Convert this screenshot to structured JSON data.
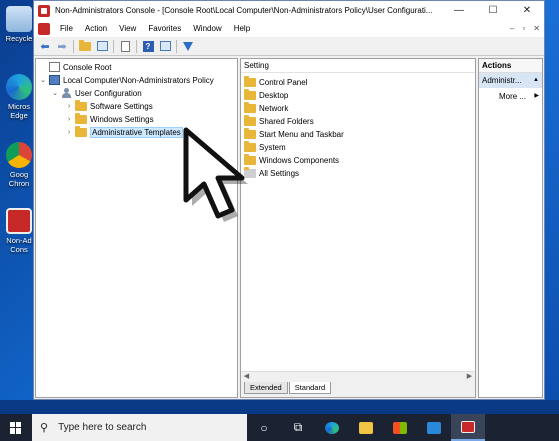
{
  "desktop": {
    "icons": [
      {
        "label": "Recycle",
        "icon": "recycle-bin-icon"
      },
      {
        "label": "Micros Edge",
        "icon": "edge-icon"
      },
      {
        "label": "Goog Chron",
        "icon": "chrome-icon"
      },
      {
        "label": "Non-Ad Cons",
        "icon": "mmc-shortcut-icon"
      }
    ]
  },
  "window": {
    "title": "Non-Administrators Console - [Console Root\\Local Computer\\Non-Administrators Policy\\User Configurati...",
    "controls": {
      "minimize": "—",
      "maximize": "☐",
      "close": "✕"
    },
    "menu": [
      "File",
      "Action",
      "View",
      "Favorites",
      "Window",
      "Help"
    ],
    "mdi_controls": {
      "minimize": "–",
      "restore": "▫",
      "close": "✕"
    }
  },
  "tree": {
    "nodes": [
      {
        "label": "Console Root",
        "level": 0,
        "icon": "console-root-icon",
        "expander": ""
      },
      {
        "label": "Local Computer\\Non-Administrators Policy",
        "level": 1,
        "icon": "computer-policy-icon",
        "expander": "⌄"
      },
      {
        "label": "User Configuration",
        "level": 2,
        "icon": "user-config-icon",
        "expander": "⌄"
      },
      {
        "label": "Software Settings",
        "level": 3,
        "icon": "folder-icon",
        "expander": "›"
      },
      {
        "label": "Windows Settings",
        "level": 3,
        "icon": "folder-icon",
        "expander": "›"
      },
      {
        "label": "Administrative Templates",
        "level": 3,
        "icon": "folder-icon",
        "expander": "›",
        "selected": true
      }
    ]
  },
  "list": {
    "column_header": "Setting",
    "items": [
      "Control Panel",
      "Desktop",
      "Network",
      "Shared Folders",
      "Start Menu and Taskbar",
      "System",
      "Windows Components",
      "All Settings"
    ],
    "tabs": [
      "Extended",
      "Standard"
    ],
    "active_tab": "Standard"
  },
  "actions": {
    "header": "Actions",
    "section": "Administr...",
    "more": "More ...",
    "section_arrow": "▲",
    "more_arrow": "▶"
  },
  "taskbar": {
    "search_placeholder": "Type here to search",
    "apps": [
      "task-view-icon",
      "edge-icon",
      "file-explorer-icon",
      "store-icon",
      "mail-icon",
      "mmc-icon"
    ]
  }
}
